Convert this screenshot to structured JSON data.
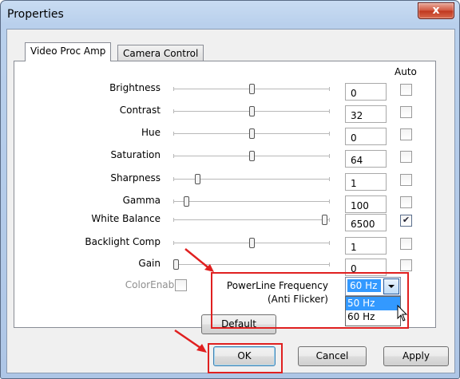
{
  "window": {
    "title": "Properties",
    "close_glyph": "x"
  },
  "tabs": [
    {
      "label": "Video Proc Amp",
      "active": true
    },
    {
      "label": "Camera Control",
      "active": false
    }
  ],
  "auto_header": "Auto",
  "controls": [
    {
      "label": "Brightness",
      "value": "0",
      "level": 0.5,
      "auto": false
    },
    {
      "label": "Contrast",
      "value": "32",
      "level": 0.5,
      "auto": false
    },
    {
      "label": "Hue",
      "value": "0",
      "level": 0.5,
      "auto": false
    },
    {
      "label": "Saturation",
      "value": "64",
      "level": 0.5,
      "auto": false
    },
    {
      "label": "Sharpness",
      "value": "1",
      "level": 0.14,
      "auto": false
    },
    {
      "label": "Gamma",
      "value": "100",
      "level": 0.07,
      "auto": false
    },
    {
      "label": "White Balance",
      "value": "6500",
      "level": 0.98,
      "auto": true
    },
    {
      "label": "Backlight Comp",
      "value": "1",
      "level": 0.5,
      "auto": false
    },
    {
      "label": "Gain",
      "value": "0",
      "level": 0.0,
      "auto": false
    }
  ],
  "color_enable": {
    "label": "ColorEnable",
    "checked": false
  },
  "powerline": {
    "label_line1": "PowerLine Frequency",
    "label_line2": "(Anti Flicker)",
    "selected": "60 Hz",
    "options": [
      "50 Hz",
      "60 Hz"
    ],
    "highlighted_option": "50 Hz"
  },
  "buttons": {
    "default": "Default",
    "ok": "OK",
    "cancel": "Cancel",
    "apply": "Apply"
  },
  "colors": {
    "annotation_red": "#e02020",
    "selection_blue": "#3399ff"
  },
  "icons": {
    "close": "close-icon",
    "dropdown": "chevron-down-icon",
    "pointer": "mouse-pointer-icon",
    "annotation": "red-arrow-icon"
  }
}
